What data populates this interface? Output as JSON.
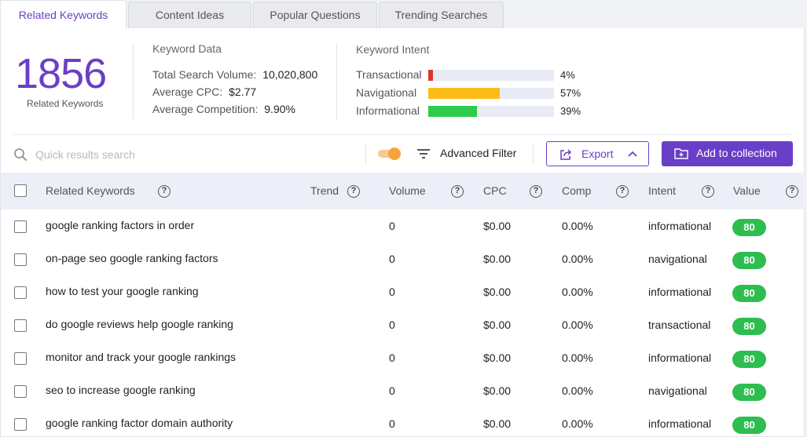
{
  "tabs": [
    {
      "label": "Related Keywords",
      "active": true
    },
    {
      "label": "Content Ideas",
      "active": false
    },
    {
      "label": "Popular Questions",
      "active": false
    },
    {
      "label": "Trending Searches",
      "active": false
    }
  ],
  "summary": {
    "count": "1856",
    "count_label": "Related Keywords",
    "keyword_data": {
      "title": "Keyword Data",
      "total_volume_label": "Total Search Volume:",
      "total_volume": "10,020,800",
      "avg_cpc_label": "Average CPC:",
      "avg_cpc": "$2.77",
      "avg_comp_label": "Average Competition:",
      "avg_comp": "9.90%"
    },
    "intent": {
      "title": "Keyword Intent",
      "items": [
        {
          "label": "Transactional",
          "pct": "4%",
          "fraction": 0.04,
          "color": "#d93a2b"
        },
        {
          "label": "Navigational",
          "pct": "57%",
          "fraction": 0.57,
          "color": "#fbbc18"
        },
        {
          "label": "Informational",
          "pct": "39%",
          "fraction": 0.39,
          "color": "#2ecb4e"
        }
      ]
    }
  },
  "toolbar": {
    "search_placeholder": "Quick results search",
    "filter_label": "Advanced Filter",
    "export_label": "Export",
    "add_label": "Add to collection"
  },
  "table": {
    "headers": {
      "keyword": "Related Keywords",
      "trend": "Trend",
      "volume": "Volume",
      "cpc": "CPC",
      "comp": "Comp",
      "intent": "Intent",
      "value": "Value"
    },
    "rows": [
      {
        "keyword": "google ranking factors in order",
        "volume": "0",
        "cpc": "$0.00",
        "comp": "0.00%",
        "intent": "informational",
        "value": "80"
      },
      {
        "keyword": "on-page seo google ranking factors",
        "volume": "0",
        "cpc": "$0.00",
        "comp": "0.00%",
        "intent": "navigational",
        "value": "80"
      },
      {
        "keyword": "how to test your google ranking",
        "volume": "0",
        "cpc": "$0.00",
        "comp": "0.00%",
        "intent": "informational",
        "value": "80"
      },
      {
        "keyword": "do google reviews help google ranking",
        "volume": "0",
        "cpc": "$0.00",
        "comp": "0.00%",
        "intent": "transactional",
        "value": "80"
      },
      {
        "keyword": "monitor and track your google rankings",
        "volume": "0",
        "cpc": "$0.00",
        "comp": "0.00%",
        "intent": "informational",
        "value": "80"
      },
      {
        "keyword": "seo to increase google ranking",
        "volume": "0",
        "cpc": "$0.00",
        "comp": "0.00%",
        "intent": "navigational",
        "value": "80"
      },
      {
        "keyword": "google ranking factor domain authority",
        "volume": "0",
        "cpc": "$0.00",
        "comp": "0.00%",
        "intent": "informational",
        "value": "80"
      }
    ]
  },
  "colors": {
    "accent": "#6a3fc7",
    "value_badge": "#2ebd4f",
    "toggle": "#f5a33a"
  },
  "icons": [
    "search-icon",
    "toggle-switch",
    "filter-icon",
    "export-icon",
    "chevron-up-icon",
    "add-folder-icon",
    "help-icon",
    "checkbox"
  ]
}
